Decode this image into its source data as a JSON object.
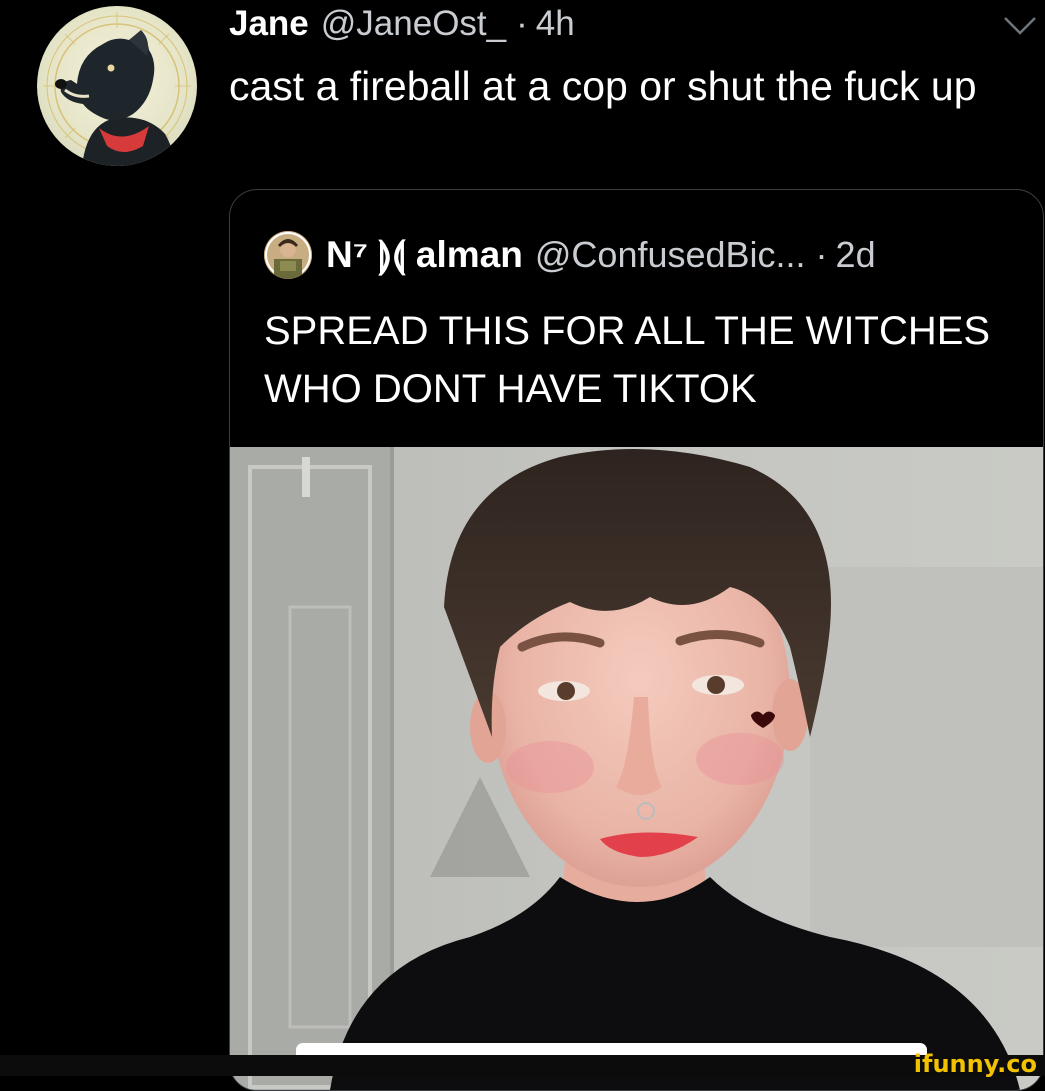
{
  "tweet": {
    "author_name": "Jane",
    "author_handle": "@JaneOst_",
    "separator": "·",
    "time": "4h",
    "text": "cast a fireball at a cop or shut the fuck up",
    "avatar_icon": "dog-avatar-icon",
    "menu_icon": "chevron-down-icon"
  },
  "quoted_tweet": {
    "author_name": "N⁷ ⟭⟬ alman",
    "author_handle": "@ConfusedBic...",
    "separator": "·",
    "time": "2d",
    "text": "SPREAD THIS FOR ALL THE WITCHES WHO DONT HAVE TIKTOK",
    "avatar_icon": "person-avatar-icon",
    "media_icon": "video-thumbnail-portrait"
  },
  "watermark": "ifunny.co",
  "colors": {
    "background": "#000000",
    "text_primary": "#ffffff",
    "text_secondary": "#c9cdd1",
    "border": "#3a3f44",
    "watermark": "#f2c100"
  }
}
